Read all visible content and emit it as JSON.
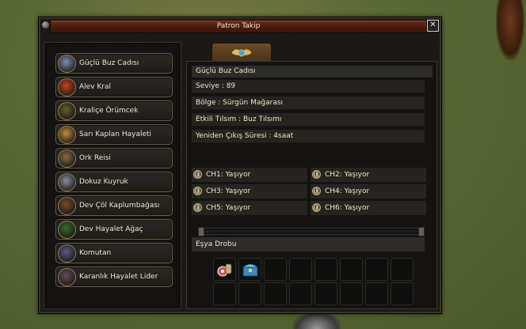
{
  "window": {
    "title": "Patron Takip",
    "close_glyph": "✕"
  },
  "bosses": [
    {
      "label": "Güçlü Buz Cadısı",
      "icon": "ice-witch-avatar-icon",
      "color": "#7a8fb0"
    },
    {
      "label": "Alev Kral",
      "icon": "flame-king-avatar-icon",
      "color": "#c0441c"
    },
    {
      "label": "Kraliçe Örümcek",
      "icon": "queen-spider-avatar-icon",
      "color": "#6a5a2a"
    },
    {
      "label": "Sarı Kaplan Hayaleti",
      "icon": "yellow-tiger-ghost-avatar-icon",
      "color": "#c08a3a"
    },
    {
      "label": "Ork Reisi",
      "icon": "orc-chief-avatar-icon",
      "color": "#8a6a4a"
    },
    {
      "label": "Dokuz Kuyruk",
      "icon": "nine-tails-avatar-icon",
      "color": "#8a8aa0"
    },
    {
      "label": "Dev Çöl Kaplumbağası",
      "icon": "desert-turtle-avatar-icon",
      "color": "#7a4a2a"
    },
    {
      "label": "Dev Hayalet Ağaç",
      "icon": "ghost-tree-avatar-icon",
      "color": "#3a6a2a"
    },
    {
      "label": "Komutan",
      "icon": "commander-avatar-icon",
      "color": "#5a5a8a"
    },
    {
      "label": "Karanlık Hayalet Lider",
      "icon": "dark-ghost-leader-avatar-icon",
      "color": "#6a4a5a"
    }
  ],
  "detail": {
    "name": "Güçlü Buz Cadısı",
    "level": "Seviye : 89",
    "region": "Bölge : Sürgün Mağarası",
    "talisman": "Etkili Tılsım : Buz Tılsımı",
    "respawn": "Yeniden Çıkış Süresi : 4saat"
  },
  "channels": [
    {
      "label": "CH1: Yaşıyor",
      "icon": "channel-status-icon"
    },
    {
      "label": "CH2: Yaşıyor",
      "icon": "channel-status-icon"
    },
    {
      "label": "CH3: Yaşıyor",
      "icon": "channel-status-icon"
    },
    {
      "label": "CH4: Yaşıyor",
      "icon": "channel-status-icon"
    },
    {
      "label": "CH5: Yaşıyor",
      "icon": "channel-status-icon"
    },
    {
      "label": "CH6: Yaşıyor",
      "icon": "channel-status-icon"
    }
  ],
  "drops": {
    "header": "Eşya Drobu",
    "items": [
      {
        "icon": "potion-pouch-item-icon"
      },
      {
        "icon": "treasure-chest-item-icon"
      }
    ]
  },
  "colors": {
    "title_bar": "#5a2416",
    "panel_bg": "#141312",
    "text": "#efe4cc"
  }
}
